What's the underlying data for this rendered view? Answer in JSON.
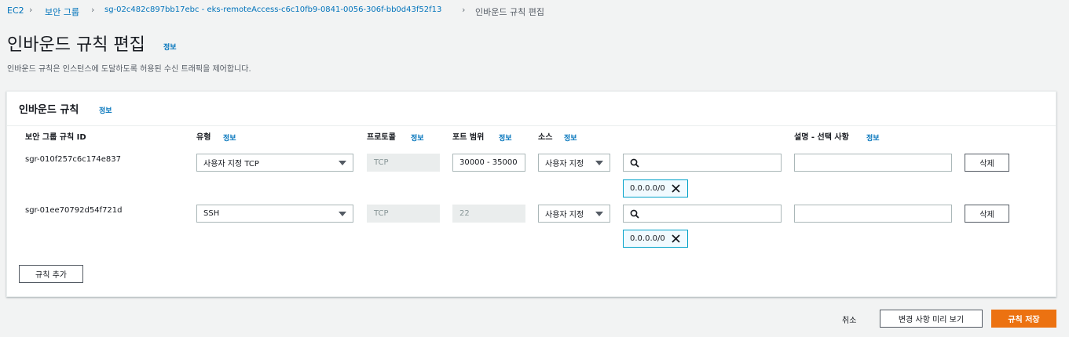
{
  "breadcrumb": {
    "items": [
      "EC2",
      "보안 그룹",
      "sg-02c482c897bb17ebc - eks-remoteAccess-c6c10fb9-0841-0056-306f-bb0d43f52f13"
    ],
    "current": "인바운드 규칙 편집"
  },
  "page": {
    "title": "인바운드 규칙 편집",
    "info": "정보",
    "description": "인바운드 규칙은 인스턴스에 도달하도록 허용된 수신 트래픽을 제어합니다."
  },
  "panel": {
    "title": "인바운드 규칙",
    "info": "정보",
    "columns": {
      "rule_id": "보안 그룹 규칙 ID",
      "type": "유형",
      "protocol": "프로토콜",
      "port_range": "포트 범위",
      "source": "소스",
      "description": "설명 - 선택 사항",
      "info": "정보"
    },
    "rows": [
      {
        "rule_id": "sgr-010f257c6c174e837",
        "type": "사용자 지정 TCP",
        "protocol": "TCP",
        "port_range": "30000 - 35000",
        "source": "사용자 지정",
        "search": "",
        "token": "0.0.0.0/0",
        "description": "",
        "delete": "삭제"
      },
      {
        "rule_id": "sgr-01ee70792d54f721d",
        "type": "SSH",
        "protocol": "TCP",
        "port_range": "22",
        "source": "사용자 지정",
        "search": "",
        "token": "0.0.0.0/0",
        "description": "",
        "delete": "삭제"
      }
    ],
    "add_rule": "규칙 추가"
  },
  "footer": {
    "cancel": "취소",
    "preview": "변경 사항 미리 보기",
    "save": "규칙 저장"
  }
}
